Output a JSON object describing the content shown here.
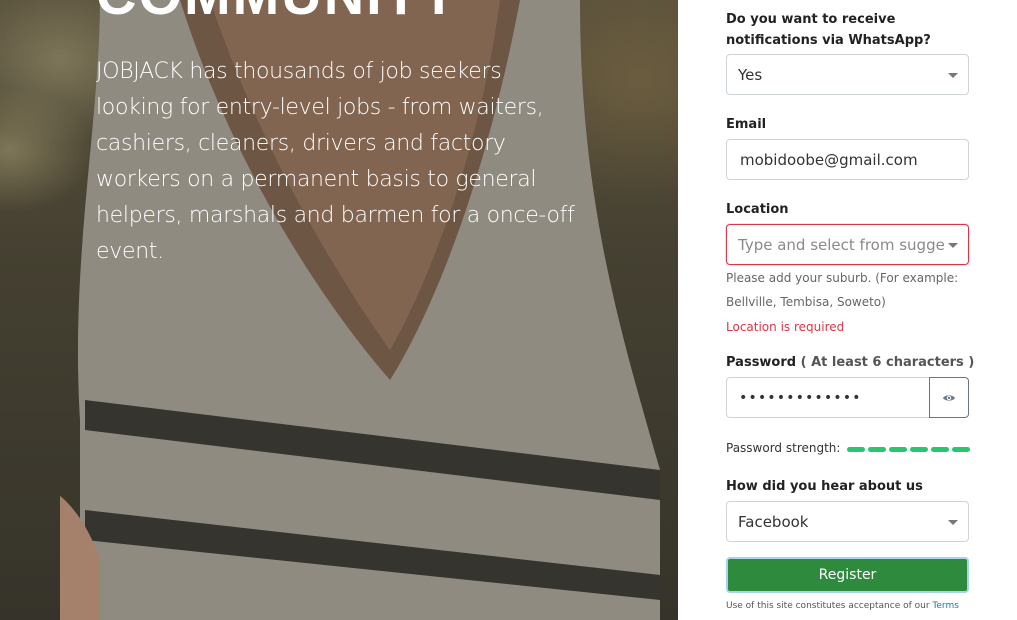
{
  "hero": {
    "heading": "COMMUNITY",
    "text": "JOBJACK has thousands of job seekers looking for entry-level jobs - from waiters, cashiers, cleaners, drivers and factory workers on a permanent basis to general helpers, marshals and barmen for a once-off event."
  },
  "form": {
    "whatsapp": {
      "label": "Do you want to receive notifications via WhatsApp?",
      "value": "Yes"
    },
    "email": {
      "label": "Email",
      "value": "mobidoobe@gmail.com"
    },
    "location": {
      "label": "Location",
      "placeholder": "Type and select from suggest",
      "help": "Please add your suburb. (For example: Bellville, Tembisa, Soweto)",
      "error": "Location is required"
    },
    "password": {
      "label": "Password",
      "hint": "( At least 6 characters )",
      "masked_value": "•••••••••••••",
      "strength_label": "Password strength:",
      "strength_level": 1.0,
      "strength_color": "#28c76f"
    },
    "hear_about": {
      "label": "How did you hear about us",
      "value": "Facebook"
    },
    "register_label": "Register",
    "terms_text": "Use of this site constitutes acceptance of our ",
    "terms_link": "Terms"
  },
  "colors": {
    "register_bg": "#2e8b3e",
    "error": "#dc3545"
  }
}
